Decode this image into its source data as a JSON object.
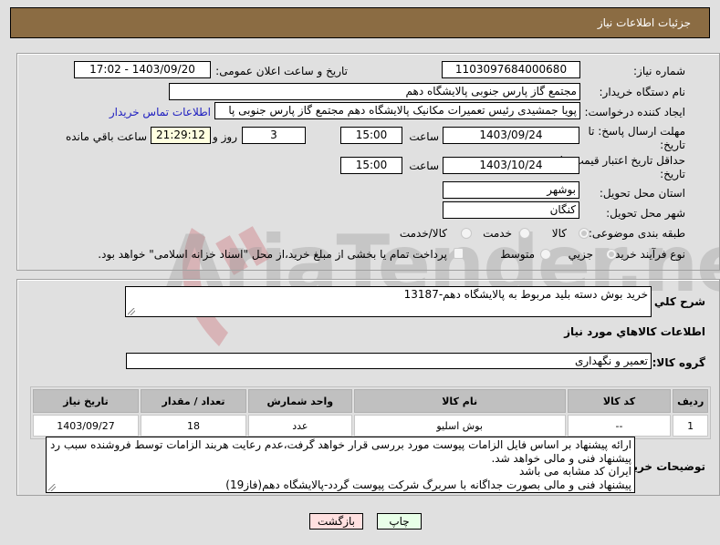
{
  "header": {
    "title": "جزئیات اطلاعات نیاز"
  },
  "form": {
    "need_number": {
      "label": "شماره نیاز:",
      "value": "1103097684000680"
    },
    "announce_datetime": {
      "label": "تاریخ و ساعت اعلان عمومی:",
      "value": "1403/09/20 - 17:02"
    },
    "buyer_org": {
      "label": "نام دستگاه خریدار:",
      "value": "مجتمع گاز پارس جنوبی  پالایشگاه دهم"
    },
    "requester": {
      "label": "ایجاد کننده درخواست:",
      "value": "پویا جمشیدی رئیس تعمیرات مکانیک پالایشگاه دهم  مجتمع گاز پارس جنوبی  پا",
      "contact_link": "اطلاعات تماس خریدار"
    },
    "reply_deadline": {
      "label_line1": "مهلت ارسال پاسخ: تا",
      "label_line2": "تاریخ:",
      "date": "1403/09/24",
      "time_label": "ساعت",
      "time": "15:00",
      "days": "3",
      "days_label": "روز و",
      "remaining": "21:29:12",
      "remaining_label": "ساعت باقي مانده"
    },
    "price_validity": {
      "label_line1": "حداقل تاریخ اعتبار قیمت: تا",
      "label_line2": "تاریخ:",
      "date": "1403/10/24",
      "time_label": "ساعت",
      "time": "15:00"
    },
    "province": {
      "label": "استان محل تحویل:",
      "value": "بوشهر"
    },
    "city": {
      "label": "شهر محل تحویل:",
      "value": "کنگان"
    },
    "category": {
      "label": "طبقه بندی موضوعی:",
      "options": [
        "کالا",
        "خدمت",
        "کالا/خدمت"
      ],
      "selected": "کالا"
    },
    "process": {
      "label": "نوع فرآیند خرید :",
      "options": [
        "جزیي",
        "متوسط"
      ],
      "selected": "جزیي",
      "treasury_checkbox_label": "پرداخت تمام یا بخشی از مبلغ خرید،از محل \"اسناد خزانه اسلامی\" خواهد بود.",
      "treasury_checked": false
    }
  },
  "details": {
    "summary_label": "شرح کلي نياز:",
    "summary_value": "خرید بوش دسته بلید مربوط به پالایشگاه دهم-13187",
    "goods_section_title": "اطلاعات کالاهاي مورد نياز",
    "goods_group_label": "گروه کالا:",
    "goods_group_value": "تعمیر و نگهداری",
    "table": {
      "headers": [
        "ردیف",
        "کد کالا",
        "نام کالا",
        "واحد شمارش",
        "تعداد / مقدار",
        "تاریخ نیاز"
      ],
      "rows": [
        [
          "1",
          "--",
          "بوش اسلیو",
          "عدد",
          "18",
          "1403/09/27"
        ]
      ]
    },
    "buyer_notes_label": "توضیحات خریدار:",
    "buyer_notes_lines": [
      "ارائه پیشنهاد بر اساس فایل الزامات پیوست مورد بررسی قرار خواهد گرفت،عدم رعایت هربند الزامات توسط فروشنده سبب رد",
      "پیشنهاد فنی و مالی خواهد شد.",
      "ایران کد مشابه می باشد",
      "پیشنهاد فنی و مالی بصورت جداگانه با سربرگ شرکت پیوست گردد-پالایشگاه دهم(فاز19)"
    ]
  },
  "buttons": {
    "print": "چاپ",
    "back": "بازگشت"
  },
  "watermark": {
    "text": "AriaTender.neT"
  }
}
